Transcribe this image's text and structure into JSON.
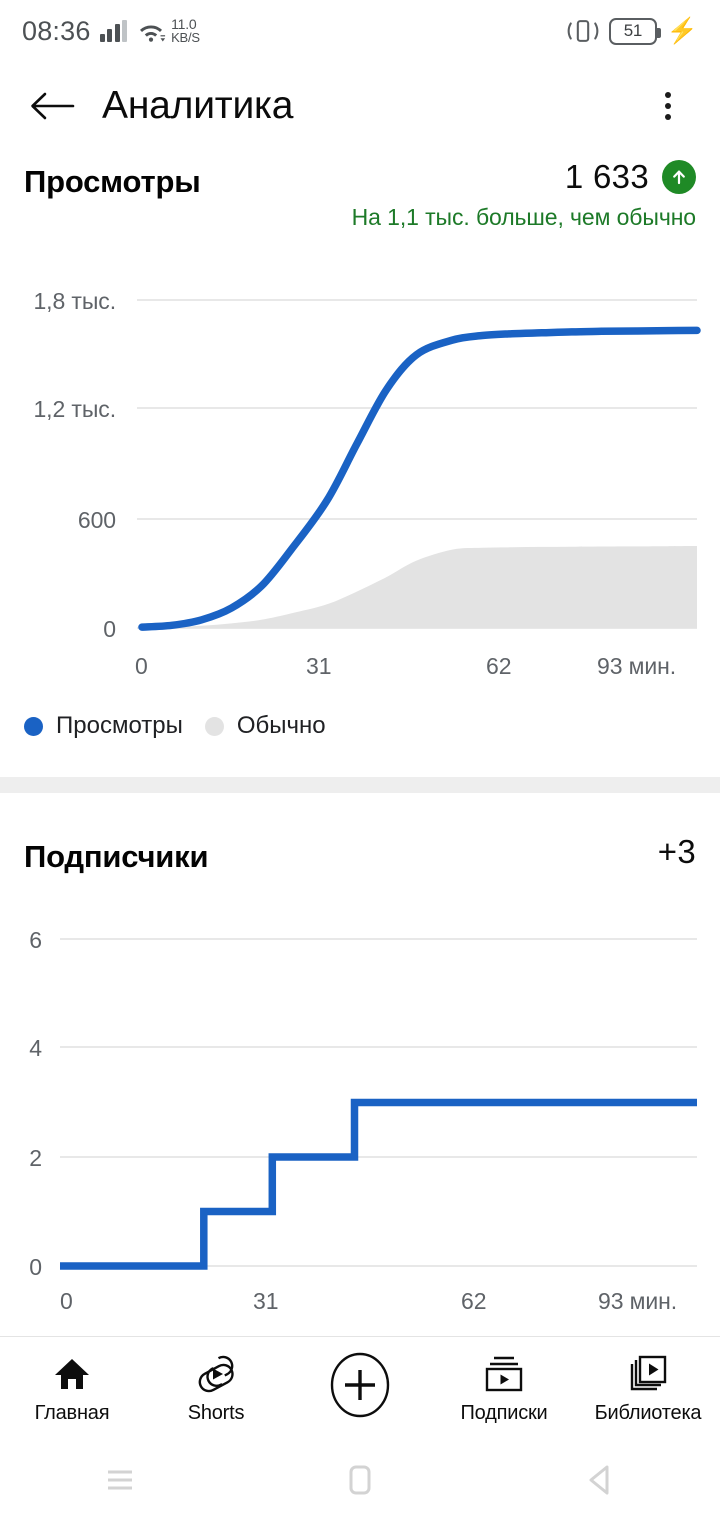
{
  "status_bar": {
    "time": "08:36",
    "network_speed_value": "11.0",
    "network_speed_unit": "KB/S",
    "battery_level": "51",
    "icons": [
      "signal-bars-icon",
      "wifi-icon",
      "vibrate-icon",
      "battery-icon",
      "charging-bolt-icon"
    ]
  },
  "app_bar": {
    "title": "Аналитика",
    "back_icon": "back-arrow-icon",
    "overflow_icon": "kebab-menu-icon"
  },
  "views_section": {
    "title": "Просмотры",
    "value": "1 633",
    "trend_icon": "arrow-up-icon",
    "trend_color": "#1f8a26",
    "subtitle": "На 1,1 тыс. больше, чем обычно",
    "legend": [
      {
        "label": "Просмотры",
        "color": "#1a62c4"
      },
      {
        "label": "Обычно",
        "color": "#e3e3e3"
      }
    ]
  },
  "subs_section": {
    "title": "Подписчики",
    "value": "+3"
  },
  "bottom_nav": {
    "items": [
      {
        "label": "Главная",
        "icon": "home-icon",
        "active": true
      },
      {
        "label": "Shorts",
        "icon": "shorts-icon",
        "active": false
      },
      {
        "label": "",
        "icon": "create-plus-icon",
        "active": false
      },
      {
        "label": "Подписки",
        "icon": "subscriptions-icon",
        "active": false
      },
      {
        "label": "Библиотека",
        "icon": "library-icon",
        "active": false
      }
    ]
  },
  "system_nav": {
    "recents_icon": "recents-menu-icon",
    "home_icon": "home-square-icon",
    "back_icon": "back-triangle-icon"
  },
  "chart_data": [
    {
      "id": "views",
      "type": "area",
      "title": "Просмотры",
      "xlabel": "мин.",
      "ylabel": "",
      "x": [
        0,
        5,
        10,
        15,
        20,
        25,
        31,
        36,
        41,
        46,
        52,
        57,
        62,
        67,
        72,
        77,
        83,
        88,
        93
      ],
      "xlim": [
        0,
        93
      ],
      "ylim": [
        0,
        1800
      ],
      "xticks": [
        0,
        31,
        62,
        93
      ],
      "xticklabels": [
        "0",
        "31",
        "62",
        "93 мин."
      ],
      "yticks": [
        0,
        600,
        1200,
        1800
      ],
      "yticklabels": [
        "0",
        "600",
        "1,2 тыс.",
        "1,8 тыс."
      ],
      "grid": true,
      "legend_position": "bottom-left",
      "series": [
        {
          "name": "Просмотры",
          "kind": "line",
          "color": "#1a62c4",
          "values": [
            5,
            15,
            45,
            110,
            230,
            430,
            700,
            1010,
            1310,
            1500,
            1580,
            1605,
            1615,
            1620,
            1625,
            1628,
            1630,
            1632,
            1633
          ]
        },
        {
          "name": "Обычно",
          "kind": "area",
          "color": "#e3e3e3",
          "values": [
            0,
            5,
            12,
            25,
            45,
            80,
            130,
            200,
            280,
            370,
            430,
            440,
            443,
            445,
            446,
            447,
            448,
            449,
            450
          ]
        }
      ]
    },
    {
      "id": "subscribers",
      "type": "line",
      "title": "Подписчики",
      "xlabel": "мин.",
      "ylabel": "",
      "x": [
        0,
        21,
        21,
        31,
        31,
        43,
        43,
        93
      ],
      "xlim": [
        0,
        93
      ],
      "ylim": [
        0,
        6
      ],
      "xticks": [
        0,
        31,
        62,
        93
      ],
      "xticklabels": [
        "0",
        "31",
        "62",
        "93 мин."
      ],
      "yticks": [
        0,
        2,
        4,
        6
      ],
      "yticklabels": [
        "0",
        "2",
        "4",
        "6"
      ],
      "grid": true,
      "step": true,
      "series": [
        {
          "name": "Подписчики",
          "kind": "step",
          "color": "#1a62c4",
          "values": [
            0,
            0,
            1,
            1,
            2,
            2,
            3,
            3
          ]
        }
      ]
    }
  ]
}
